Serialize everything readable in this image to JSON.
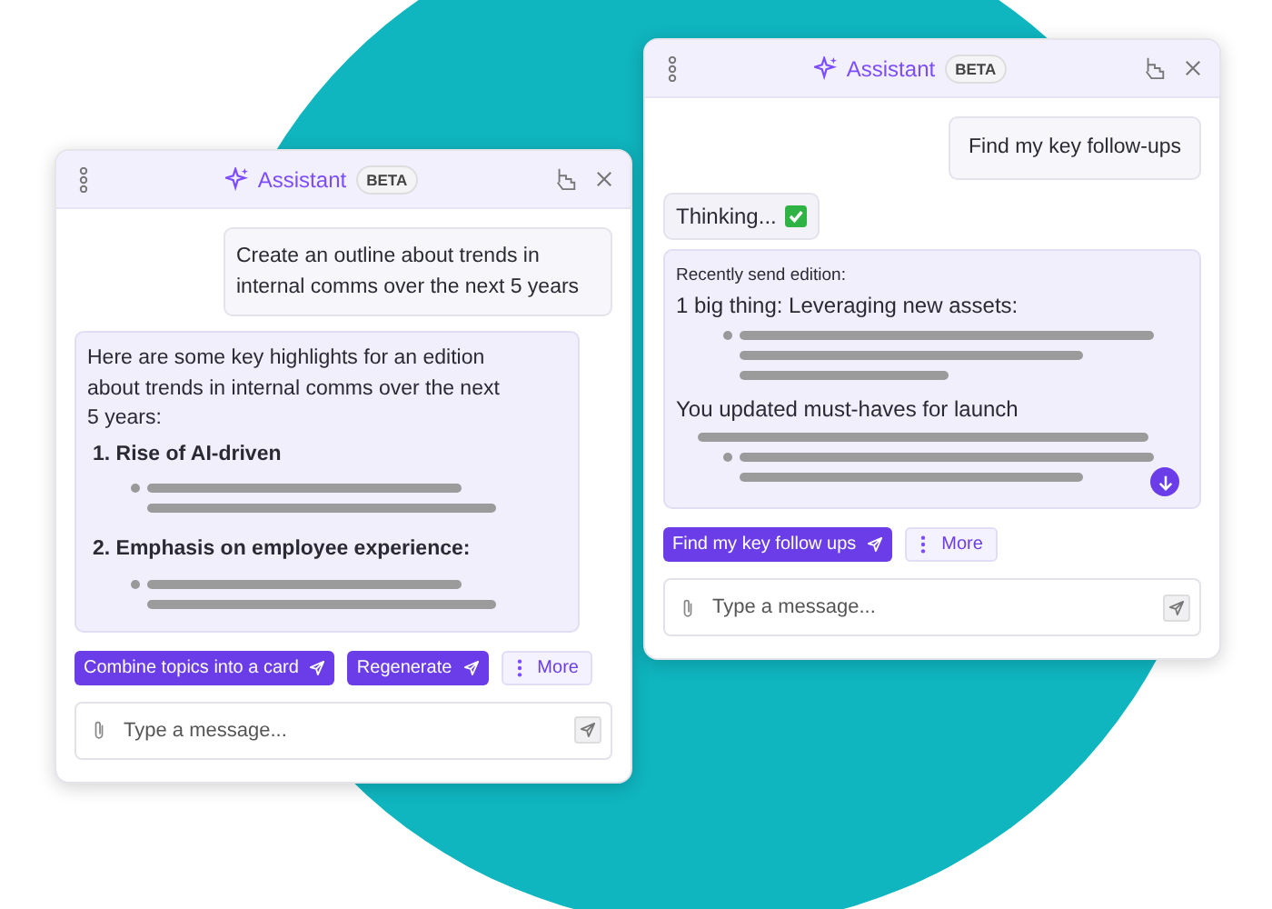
{
  "windows": [
    {
      "title": "Assistant",
      "badge": "BETA",
      "messages": [
        {
          "kind": "user",
          "text": "Create an outline about trends in internal comms over the next 5 years"
        },
        {
          "kind": "outline",
          "intro": "Here are some key highlights for an edition about trends in internal comms over the next 5 years:",
          "items": [
            {
              "number": "1.",
              "title": "Rise of AI-driven"
            },
            {
              "number": "2.",
              "title": "Emphasis on employee experience:"
            }
          ]
        }
      ],
      "actions": [
        {
          "kind": "primary",
          "label": "Combine topics into a card"
        },
        {
          "kind": "primary",
          "label": "Regenerate"
        },
        {
          "kind": "more",
          "label": "More"
        }
      ],
      "input": {
        "placeholder": "Type a message..."
      }
    },
    {
      "title": "Assistant",
      "badge": "BETA",
      "messages": [
        {
          "kind": "user",
          "text": "Find my key follow-ups"
        },
        {
          "kind": "status",
          "text": "Thinking...",
          "done": true
        },
        {
          "kind": "summary",
          "caption": "Recently send edition:",
          "items": [
            {
              "title": "1 big thing: Leveraging new assets:"
            },
            {
              "title": "You updated must-haves for launch"
            }
          ]
        }
      ],
      "actions": [
        {
          "kind": "primary",
          "label": "Find my key follow ups"
        },
        {
          "kind": "more",
          "label": "More"
        }
      ],
      "input": {
        "placeholder": "Type a message..."
      }
    }
  ]
}
